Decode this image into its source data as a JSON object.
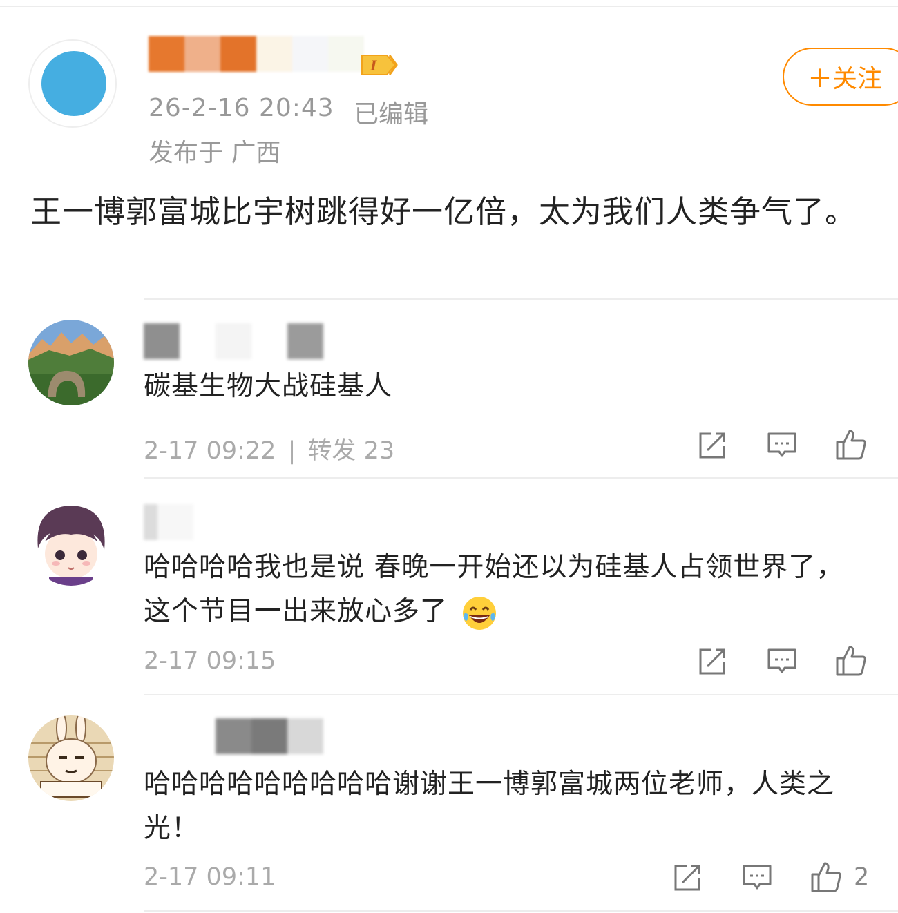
{
  "post": {
    "time": "26-2-16 20:43",
    "edited": "已编辑",
    "location": "发布于 广西",
    "follow_label": "＋关注",
    "text": "王一博郭富城比宇树跳得好一亿倍，太为我们人类争气了。",
    "colors": {
      "avatar": "#45aee1",
      "accent": "#ff8a00"
    }
  },
  "comments": [
    {
      "text": "碳基生物大战硅基人",
      "time": "2-17 09:22",
      "separator": "|",
      "repost": "转发 23",
      "likes": ""
    },
    {
      "text": "哈哈哈哈我也是说 春晚一开始还以为硅基人占领世界了，这个节目一出来放心多了",
      "emoji": "laughing-tears-icon",
      "time": "2-17 09:15",
      "likes": ""
    },
    {
      "text": "哈哈哈哈哈哈哈哈哈谢谢王一博郭富城两位老师，人类之光！",
      "time": "2-17 09:11",
      "likes": "2"
    }
  ]
}
